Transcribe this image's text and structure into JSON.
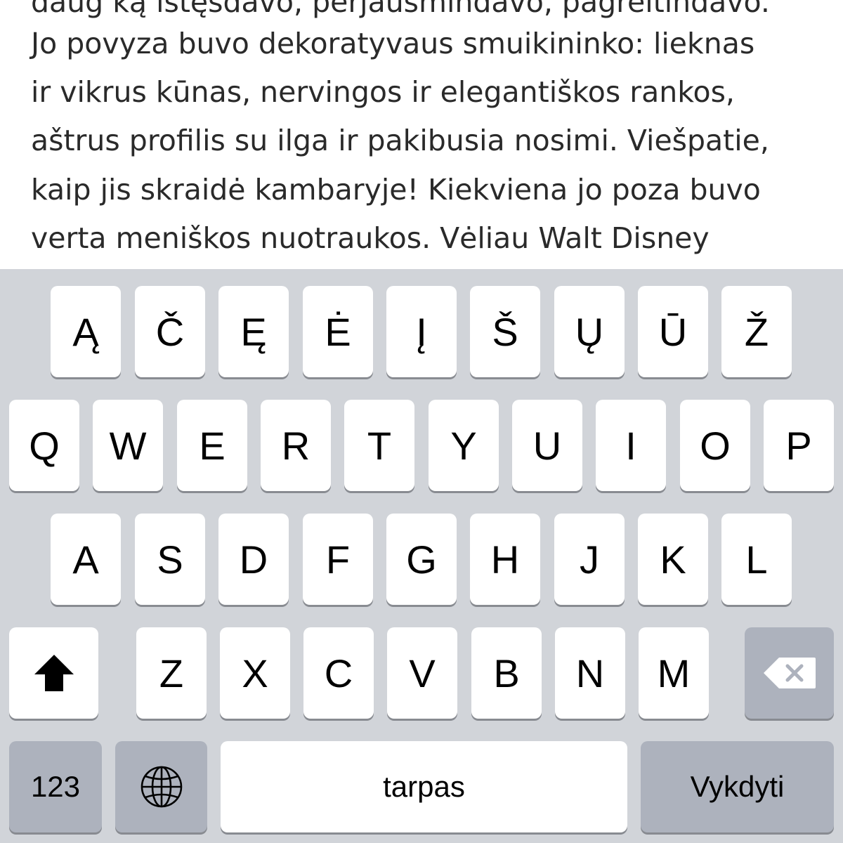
{
  "document": {
    "lines": [
      "daug ką ištęsdavo, perjausmindavo, pagreitindavo.",
      "Jo povyza buvo dekoratyvaus smuikininko: lieknas",
      "ir vikrus kūnas, nervingos ir elegantiškos rankos,",
      "aštrus profilis su ilga ir pakibusia nosimi. Viešpatie,",
      "kaip jis skraidė kambaryje! Kiekviena jo poza buvo",
      "verta meniškos nuotraukos. Vėliau Walt Disney"
    ]
  },
  "keyboard": {
    "row1": [
      "Ą",
      "Č",
      "Ę",
      "Ė",
      "Į",
      "Š",
      "Ų",
      "Ū",
      "Ž"
    ],
    "row2": [
      "Q",
      "W",
      "E",
      "R",
      "T",
      "Y",
      "U",
      "I",
      "O",
      "P"
    ],
    "row3": [
      "A",
      "S",
      "D",
      "F",
      "G",
      "H",
      "J",
      "K",
      "L"
    ],
    "row4": [
      "Z",
      "X",
      "C",
      "V",
      "B",
      "N",
      "M"
    ],
    "shift_icon": "shift-arrow-icon",
    "delete_icon": "backspace-icon",
    "globe_icon": "globe-icon",
    "numbers_label": "123",
    "space_label": "tarpas",
    "return_label": "Vykdyti",
    "colors": {
      "background": "#d1d4d9",
      "key": "#ffffff",
      "special_key": "#adb2bd",
      "key_shadow": "#888b91"
    }
  }
}
